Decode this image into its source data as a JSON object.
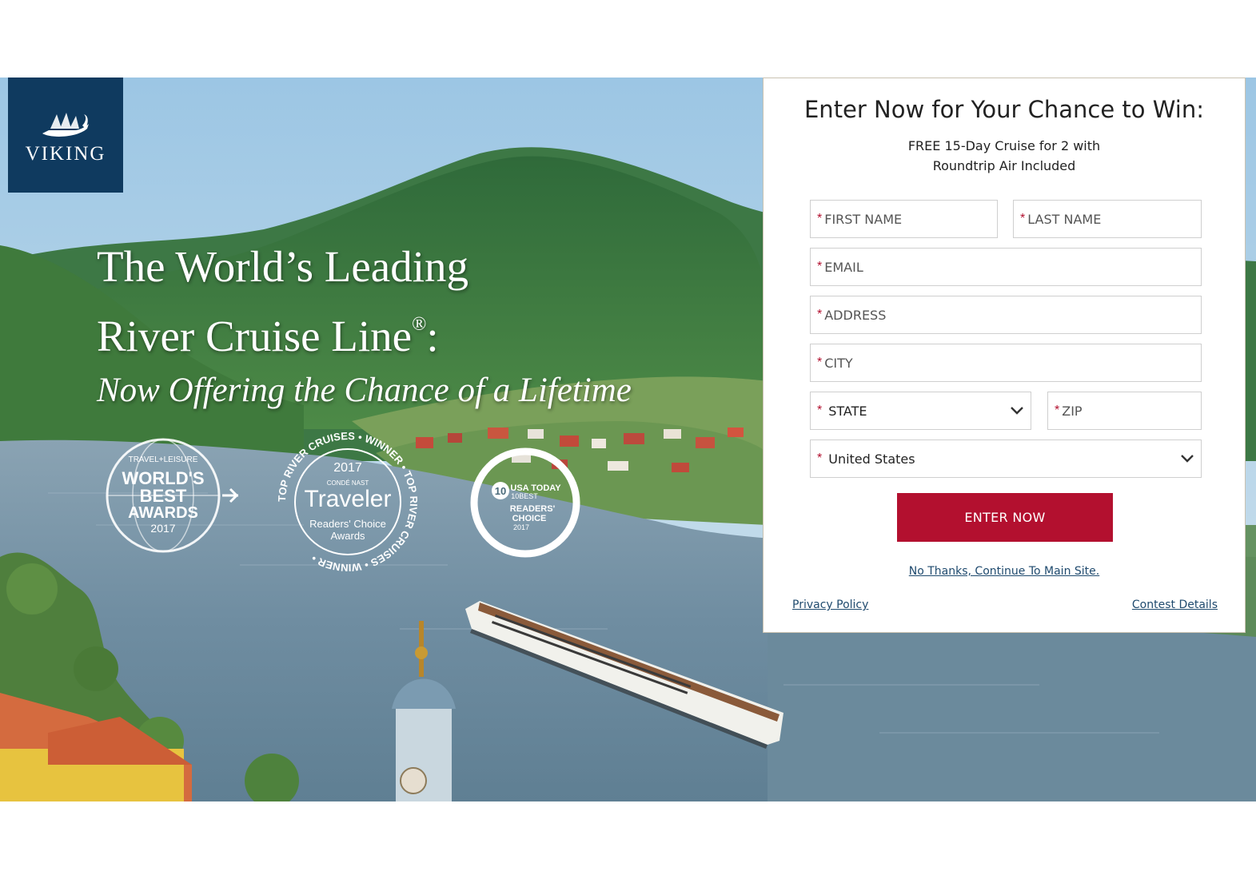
{
  "brand": {
    "logo_text": "VIKING",
    "logo_bg": "#0f3a5f"
  },
  "hero": {
    "headline_line1": "The World’s Leading",
    "headline_line2": "River Cruise Line",
    "registered_mark": "®",
    "headline_colon": ":",
    "subheadline": "Now Offering the Chance of a Lifetime"
  },
  "awards": {
    "travel_leisure": {
      "top": "TRAVEL+LEISURE",
      "line1": "WORLD'S",
      "line2": "BEST",
      "line3": "AWARDS",
      "year": "2017"
    },
    "traveler": {
      "year": "2017",
      "publisher": "CONDÉ NAST",
      "name": "Traveler",
      "line1": "Readers' Choice",
      "line2": "Awards",
      "ring_text": "TOP RIVER CRUISES • WINNER • TOP RIVER CRUISES • WINNER •"
    },
    "usa_today": {
      "number": "10",
      "brand": "USA TODAY",
      "sub": "10BEST",
      "line1": "READERS'",
      "line2": "CHOICE",
      "year": "2017"
    }
  },
  "form": {
    "title": "Enter Now for Your Chance to Win:",
    "prize_line1": "FREE 15-Day Cruise for 2 with",
    "prize_line2": "Roundtrip Air Included",
    "required_marker": "*",
    "first_name_placeholder": "FIRST NAME",
    "last_name_placeholder": "LAST NAME",
    "email_placeholder": "EMAIL",
    "address_placeholder": "ADDRESS",
    "city_placeholder": "CITY",
    "state_value": "STATE",
    "zip_placeholder": "ZIP",
    "country_value": "United States",
    "submit_label": "ENTER NOW",
    "decline_link": "No Thanks, Continue To Main Site.",
    "privacy_link": "Privacy Policy",
    "contest_link": "Contest Details"
  },
  "colors": {
    "accent": "#b3102f",
    "link": "#1f4a6e",
    "navy": "#0f3a5f"
  }
}
